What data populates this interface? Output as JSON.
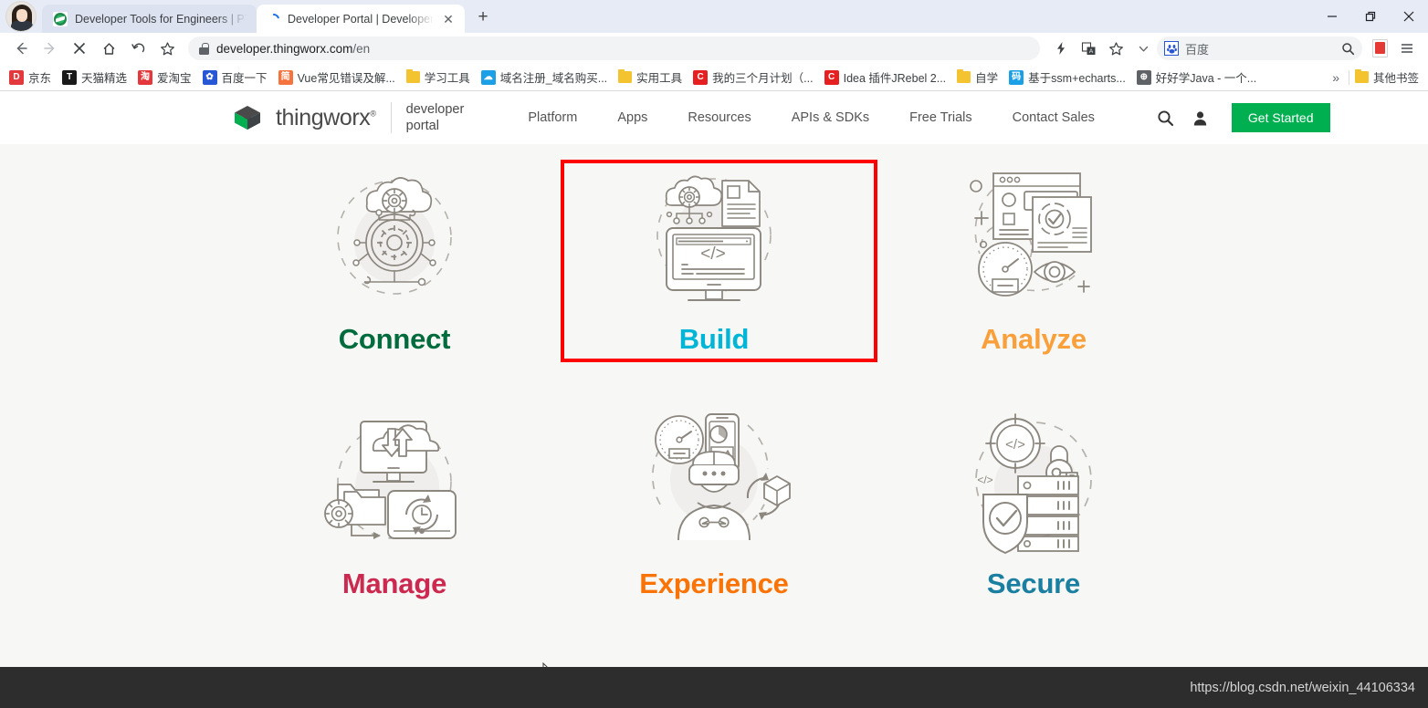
{
  "browser": {
    "tabs": [
      {
        "title": "Developer Tools for Engineers | PT",
        "favicon": "thingworx-favicon",
        "active": false
      },
      {
        "title": "Developer Portal | Developer P",
        "favicon": "loading-spinner",
        "active": true
      }
    ],
    "new_tab_label": "+",
    "window_controls": {
      "minimize": "—",
      "maximize": "❐",
      "close": "✕"
    },
    "toolbar": {
      "back_icon": "back-arrow-icon",
      "forward_icon": "forward-arrow-icon",
      "stop_icon": "stop-close-icon",
      "home_icon": "home-icon",
      "reload_icon": "reload-icon",
      "bookmark_star_icon": "star-icon",
      "url": "developer.thingworx.com",
      "url_path": "/en",
      "lock_icon": "lock-icon",
      "lightning_icon": "lightning-icon",
      "translate_icon": "translate-icon",
      "star_icon": "star-outline-icon",
      "chevron_icon": "chevron-down-icon",
      "search_engine_label": "百度",
      "search_icon": "search-icon",
      "pdf_icon": "pdf-icon",
      "menu_icon": "hamburger-menu-icon"
    },
    "bookmarks": [
      {
        "label": "京东",
        "icon_text": "D",
        "icon_color": "#e4393c",
        "type": "badge"
      },
      {
        "label": "天猫精选",
        "icon_text": "T",
        "icon_color": "#1a1a1a",
        "type": "badge"
      },
      {
        "label": "爱淘宝",
        "icon_text": "淘",
        "icon_color": "#e4393c",
        "type": "badge"
      },
      {
        "label": "百度一下",
        "icon_text": "✿",
        "icon_color": "#2857d6",
        "type": "badge"
      },
      {
        "label": "Vue常见错误及解...",
        "icon_text": "简",
        "icon_color": "#f5733c",
        "type": "badge"
      },
      {
        "label": "学习工具",
        "icon_text": "",
        "icon_color": "#f4c430",
        "type": "folder"
      },
      {
        "label": "域名注册_域名购买...",
        "icon_text": "☁",
        "icon_color": "#1ba0e8",
        "type": "badge"
      },
      {
        "label": "实用工具",
        "icon_text": "",
        "icon_color": "#f4c430",
        "type": "folder"
      },
      {
        "label": "我的三个月计划（...",
        "icon_text": "C",
        "icon_color": "#e62020",
        "type": "badge"
      },
      {
        "label": "Idea 插件JRebel 2...",
        "icon_text": "C",
        "icon_color": "#e62020",
        "type": "badge"
      },
      {
        "label": "自学",
        "icon_text": "",
        "icon_color": "#f4c430",
        "type": "folder"
      },
      {
        "label": "基于ssm+echarts...",
        "icon_text": "码",
        "icon_color": "#1ba0e8",
        "type": "badge"
      },
      {
        "label": "好好学Java - 一个...",
        "icon_text": "⊕",
        "icon_color": "#5f6368",
        "type": "badge"
      }
    ],
    "bookmarks_overflow": "»",
    "other_bookmarks": {
      "label": "其他书签",
      "icon": "folder-icon"
    },
    "status_url": "https://blog.csdn.net/weixin_44106334"
  },
  "site": {
    "logo": {
      "name": "thingworx",
      "trademark": "®"
    },
    "sub_brand_line1": "developer",
    "sub_brand_line2": "portal",
    "nav_links": [
      {
        "label": "Platform"
      },
      {
        "label": "Apps"
      },
      {
        "label": "Resources"
      },
      {
        "label": "APIs & SDKs"
      },
      {
        "label": "Free Trials"
      },
      {
        "label": "Contact Sales"
      }
    ],
    "search_icon": "search-icon",
    "account_icon": "user-account-icon",
    "cta": {
      "label": "Get Started",
      "color": "#00b050"
    },
    "cards": [
      {
        "id": "connect",
        "label": "Connect",
        "color": "#006b3c",
        "art": "connect-illustration",
        "highlighted": false
      },
      {
        "id": "build",
        "label": "Build",
        "color": "#00b5d6",
        "art": "build-illustration",
        "highlighted": true
      },
      {
        "id": "analyze",
        "label": "Analyze",
        "color": "#f9a03a",
        "art": "analyze-illustration",
        "highlighted": false
      },
      {
        "id": "manage",
        "label": "Manage",
        "color": "#cc2950",
        "art": "manage-illustration",
        "highlighted": false
      },
      {
        "id": "experience",
        "label": "Experience",
        "color": "#f97306",
        "art": "experience-illustration",
        "highlighted": false
      },
      {
        "id": "secure",
        "label": "Secure",
        "color": "#1a7fa0",
        "art": "secure-illustration",
        "highlighted": false
      }
    ],
    "annotation": {
      "type": "highlight-rectangle",
      "color": "#ff0000",
      "target": "build"
    }
  }
}
